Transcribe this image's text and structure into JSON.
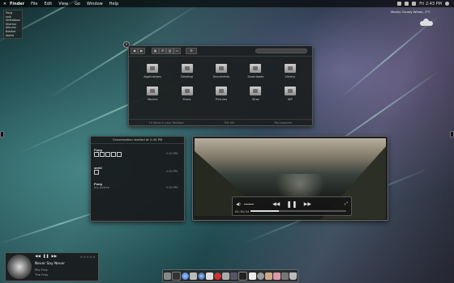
{
  "menubar": {
    "apple": "✕",
    "items": [
      "Finder",
      "File",
      "Edit",
      "View",
      "Go",
      "Window",
      "Help"
    ],
    "clock": "Fri 2:43 PM"
  },
  "dropdown": {
    "items": [
      "Pong",
      "snik",
      "ShiftsNoon",
      "Shantor",
      "Albums",
      "Bottled",
      "Idolist"
    ]
  },
  "weather": {
    "text": "Mostly Cloudy   Windy, 3°C"
  },
  "finder": {
    "search_placeholder": "",
    "items": [
      {
        "label": "Applications"
      },
      {
        "label": "Desktop"
      },
      {
        "label": "Documents"
      },
      {
        "label": "Downloads"
      },
      {
        "label": "Library"
      },
      {
        "label": "Movies"
      },
      {
        "label": "Music"
      },
      {
        "label": "Pictures"
      },
      {
        "label": "Sites"
      },
      {
        "label": "WP"
      }
    ],
    "status": [
      "10 items in your Desktop",
      "TDS HD",
      "MyComputer"
    ]
  },
  "chat": {
    "header": "Conversation started at 2:40 PM",
    "messages": [
      {
        "sender": "Pong",
        "time": "2:30 PM",
        "emotes": 5,
        "text": ""
      },
      {
        "sender": "snrki",
        "time": "2:30 PM",
        "emotes": 1,
        "text": ""
      },
      {
        "sender": "Pong",
        "time": "2:30 PM",
        "emotes": 0,
        "text": "my picture"
      }
    ]
  },
  "video": {
    "time": "01:30:34",
    "progress": 0.3
  },
  "music": {
    "controls": [
      "◀◀",
      "❚❚",
      "▶▶"
    ],
    "stars": "☆☆☆☆☆",
    "title": "Never Say Never",
    "artist": "Pile Fray",
    "album": "The Fray"
  },
  "colors": {
    "accent": "#dddddd",
    "window_bg": "#1c1e1f"
  }
}
